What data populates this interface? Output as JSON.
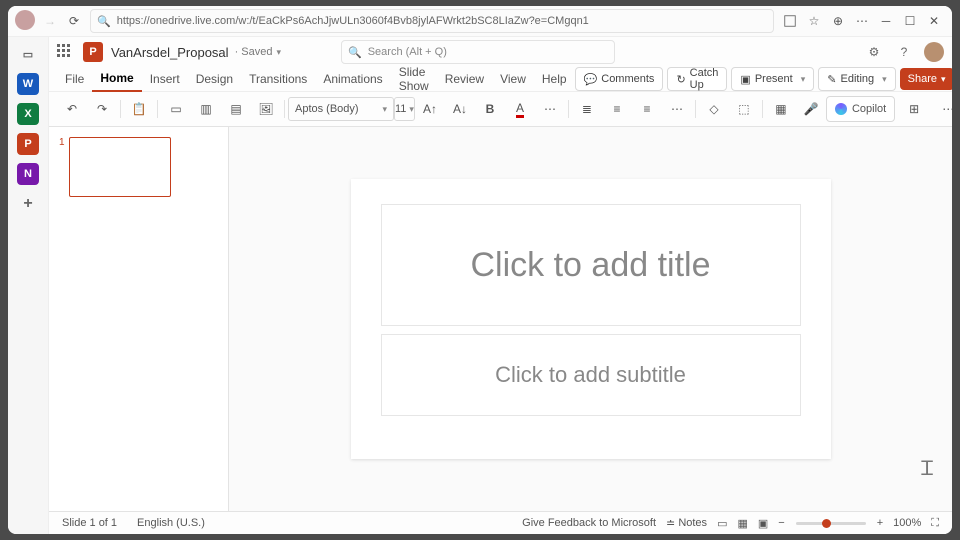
{
  "browser": {
    "url": "https://onedrive.live.com/w:/t/EaCkPs6AchJjwULn3060f4Bvb8jylAFWrkt2bSC8LIaZw?e=CMgqn1"
  },
  "rail": {
    "apps": [
      {
        "letter": "W",
        "bg": "#185abd"
      },
      {
        "letter": "X",
        "bg": "#107c41"
      },
      {
        "letter": "P",
        "bg": "#c43e1c"
      },
      {
        "letter": "N",
        "bg": "#7719aa"
      }
    ]
  },
  "title": {
    "doc": "VanArsdel_Proposal",
    "saved": "· Saved",
    "search_ph": "Search (Alt + Q)"
  },
  "tabs": [
    "File",
    "Home",
    "Insert",
    "Design",
    "Transitions",
    "Animations",
    "Slide Show",
    "Review",
    "View",
    "Help"
  ],
  "rightbar": {
    "comments": "Comments",
    "catchup": "Catch Up",
    "present": "Present",
    "editing": "Editing",
    "share": "Share"
  },
  "font": {
    "name": "Aptos (Body)",
    "size": "11"
  },
  "copilot": "Copilot",
  "slide": {
    "title_ph": "Click to add title",
    "sub_ph": "Click to add subtitle",
    "thumb_num": "1"
  },
  "status": {
    "counter": "Slide 1 of 1",
    "lang": "English (U.S.)",
    "feedback": "Give Feedback to Microsoft",
    "notes": "Notes",
    "zoom": "100%"
  }
}
